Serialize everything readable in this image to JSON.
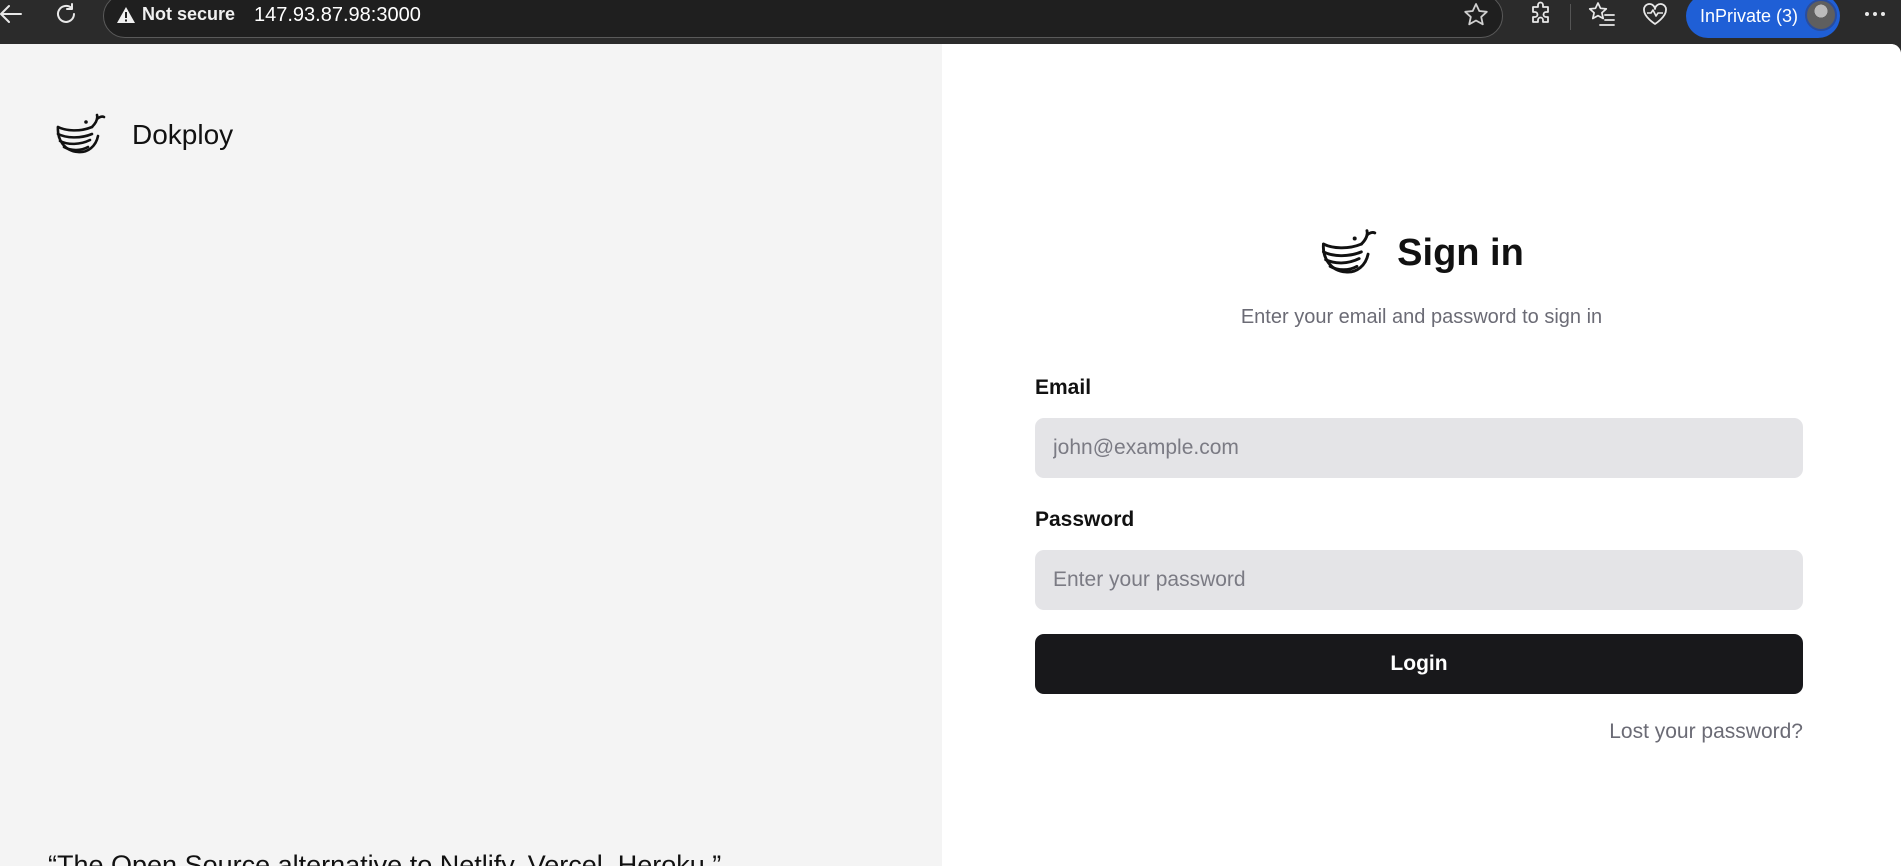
{
  "browser": {
    "security_label": "Not secure",
    "url": "147.93.87.98:3000",
    "inprivate_label": "InPrivate (3)"
  },
  "brand": {
    "name": "Dokploy"
  },
  "quote": "“The Open Source alternative to Netlify, Vercel, Heroku.”",
  "signin": {
    "title": "Sign in",
    "subtitle": "Enter your email and password to sign in",
    "email_label": "Email",
    "email_placeholder": "john@example.com",
    "password_label": "Password",
    "password_placeholder": "Enter your password",
    "login_label": "Login",
    "lost_password": "Lost your password?"
  },
  "icons": {
    "back": "back-arrow-icon",
    "refresh": "refresh-icon",
    "warning": "warning-icon",
    "favorite": "star-icon",
    "extensions": "puzzle-icon",
    "favorites_list": "favorites-icon",
    "health": "heartbeat-icon",
    "more": "more-icon",
    "logo": "whale-logo-icon"
  },
  "colors": {
    "accent_inprivate": "#1f5fd6",
    "login_button": "#18181b",
    "input_bg": "#e4e4e7",
    "left_panel_bg": "#f4f4f4"
  }
}
